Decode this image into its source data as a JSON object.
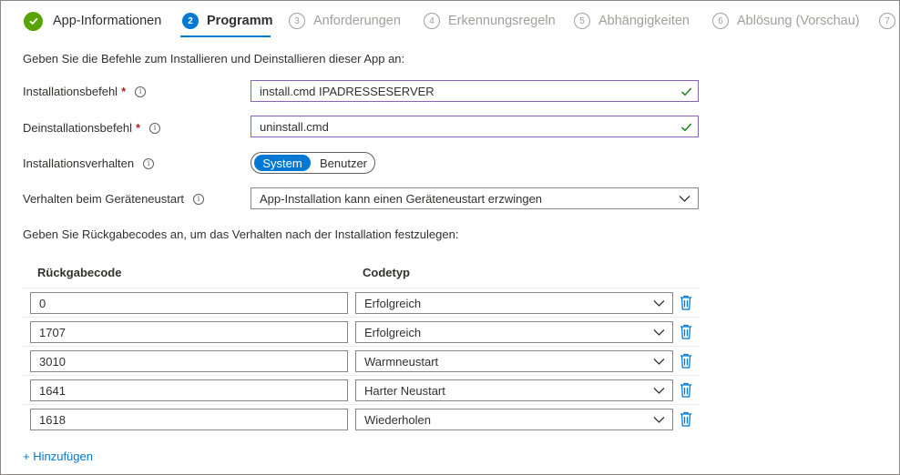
{
  "wizard": {
    "steps": [
      {
        "number": "",
        "label": "App-Informationen",
        "state": "done"
      },
      {
        "number": "2",
        "label": "Programm",
        "state": "active"
      },
      {
        "number": "3",
        "label": "Anforderungen",
        "state": "pending"
      },
      {
        "number": "4",
        "label": "Erkennungsregeln",
        "state": "pending"
      },
      {
        "number": "5",
        "label": "Abhängigkeiten",
        "state": "pending"
      },
      {
        "number": "6",
        "label": "Ablösung (Vorschau)",
        "state": "pending"
      },
      {
        "number": "7",
        "label": "",
        "state": "pending"
      }
    ]
  },
  "form": {
    "intro": "Geben Sie die Befehle zum Installieren und Deinstallieren dieser App an:",
    "install_command": {
      "label": "Installationsbefehl",
      "required_mark": "*",
      "value": "install.cmd IPADRESSESERVER"
    },
    "uninstall_command": {
      "label": "Deinstallationsbefehl",
      "required_mark": "*",
      "value": "uninstall.cmd"
    },
    "install_behavior": {
      "label": "Installationsverhalten",
      "options": [
        "System",
        "Benutzer"
      ],
      "selected": "System"
    },
    "restart_behavior": {
      "label": "Verhalten beim Geräteneustart",
      "value": "App-Installation kann einen Geräteneustart erzwingen"
    }
  },
  "return_codes": {
    "description": "Geben Sie Rückgabecodes an, um das Verhalten nach der Installation festzulegen:",
    "columns": [
      "Rückgabecode",
      "Codetyp"
    ],
    "rows": [
      {
        "code": "0",
        "type": "Erfolgreich"
      },
      {
        "code": "1707",
        "type": "Erfolgreich"
      },
      {
        "code": "3010",
        "type": "Warmneustart"
      },
      {
        "code": "1641",
        "type": "Harter Neustart"
      },
      {
        "code": "1618",
        "type": "Wiederholen"
      }
    ],
    "add_label": "+ Hinzufügen"
  },
  "info_glyph": "i",
  "icons": {
    "check": "checkmark-icon",
    "info": "info-icon",
    "chevron": "chevron-down-icon",
    "delete": "trash-icon"
  },
  "colors": {
    "accent": "#0078d4",
    "success": "#57a300",
    "valid_border": "#8764b8",
    "required": "#a4262c"
  }
}
